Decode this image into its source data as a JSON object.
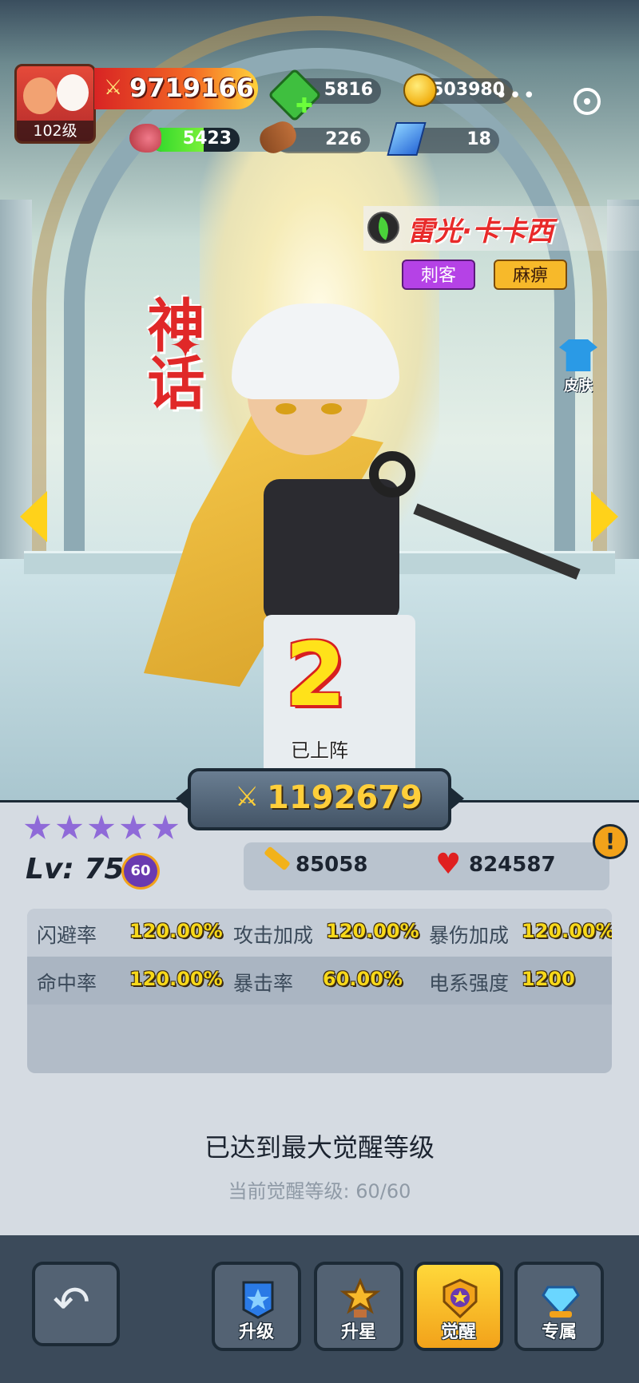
{
  "player": {
    "level": "102级",
    "power": "9719166"
  },
  "resources": {
    "gems": "5816",
    "coins": "503980",
    "meat": "5423",
    "meat_fill_pct": 60,
    "wood": "226",
    "crystals": "18"
  },
  "hero": {
    "name": "雷光·卡卡西",
    "tags": [
      "刺客",
      "麻痹"
    ],
    "rarity": "神话",
    "skin_label": "皮肤",
    "deploy_slot": "2",
    "deploy_status": "已上阵",
    "combat_power": "1192679",
    "stars": 5,
    "level_label": "Lv: 75",
    "awaken_badge": "60",
    "attack": "85058",
    "hp": "824587"
  },
  "attributes": [
    [
      {
        "key": "闪避率",
        "value": "120.00%"
      },
      {
        "key": "攻击加成",
        "value": "120.00%"
      },
      {
        "key": "暴伤加成",
        "value": "120.00%"
      }
    ],
    [
      {
        "key": "命中率",
        "value": "120.00%"
      },
      {
        "key": "暴击率",
        "value": "60.00%"
      },
      {
        "key": "电系强度",
        "value": "1200"
      }
    ]
  ],
  "awaken": {
    "max_message": "已达到最大觉醒等级",
    "current_label": "当前觉醒等级: 60/60"
  },
  "nav": [
    {
      "label": "升级",
      "icon": "upgrade-icon"
    },
    {
      "label": "升星",
      "icon": "star-up-icon"
    },
    {
      "label": "觉醒",
      "icon": "awaken-icon",
      "active": true
    },
    {
      "label": "专属",
      "icon": "exclusive-icon"
    }
  ],
  "colors": {
    "accent": "#f2a21a",
    "name_red": "#e82a2a",
    "attr_value": "#f7d81a",
    "nav_bg": "#3b4a5a"
  }
}
